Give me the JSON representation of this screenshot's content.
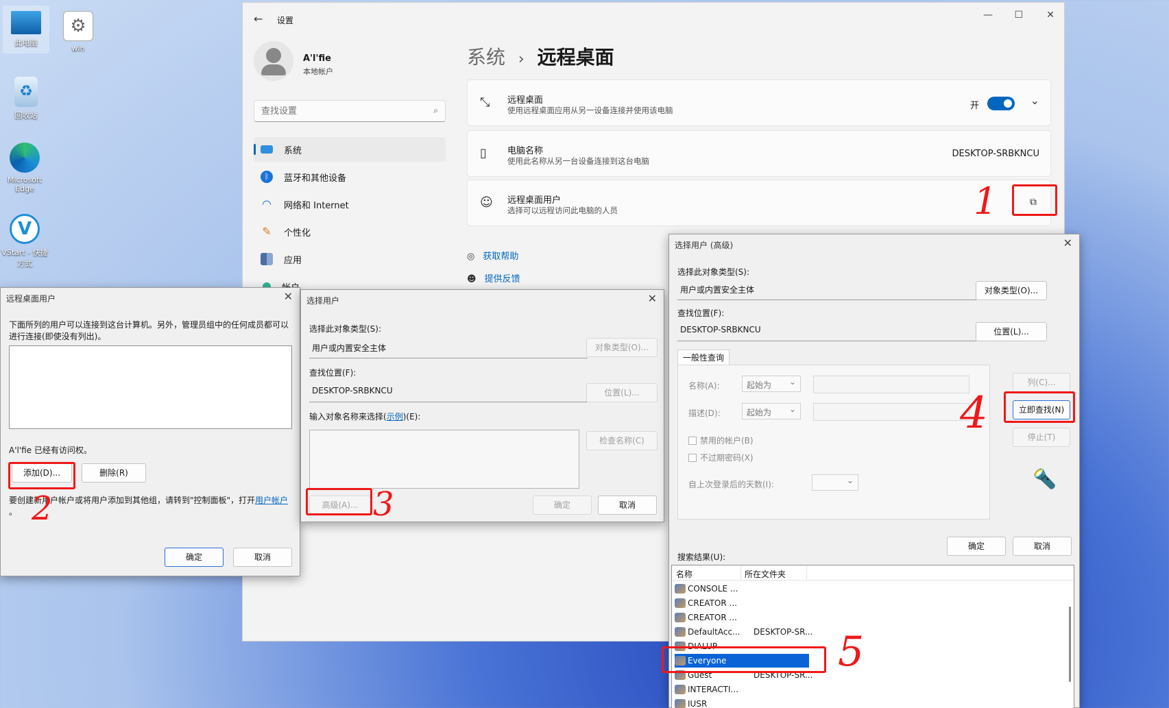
{
  "desktop": {
    "icons": [
      {
        "label": "此电脑"
      },
      {
        "label": "win"
      },
      {
        "label": "回收站"
      },
      {
        "label": "Microsoft Edge"
      },
      {
        "label": "VStart - 快捷方式"
      }
    ]
  },
  "settings": {
    "caption": "设置",
    "user_name": "A'l'fie",
    "user_type": "本地帐户",
    "search_placeholder": "查找设置",
    "nav": [
      {
        "label": "系统"
      },
      {
        "label": "蓝牙和其他设备"
      },
      {
        "label": "网络和 Internet"
      },
      {
        "label": "个性化"
      },
      {
        "label": "应用"
      },
      {
        "label": "帐户"
      }
    ],
    "breadcrumb_parent": "系统",
    "breadcrumb_sep": "›",
    "page_title": "远程桌面",
    "cards": {
      "remote_desktop": {
        "title": "远程桌面",
        "sub": "使用远程桌面应用从另一设备连接并使用该电脑",
        "toggle_label": "开"
      },
      "pc_name": {
        "title": "电脑名称",
        "sub": "使用此名称从另一台设备连接到这台电脑",
        "value": "DESKTOP-SRBKNCU"
      },
      "rd_users": {
        "title": "远程桌面用户",
        "sub": "选择可以远程访问此电脑的人员"
      }
    },
    "help": "获取帮助",
    "feedback": "提供反馈"
  },
  "rdu_dialog": {
    "title": "远程桌面用户",
    "desc": "下面所列的用户可以连接到这台计算机。另外，管理员组中的任何成员都可以进行连接(即使没有列出)。",
    "access_text": "A'l'fie 已经有访问权。",
    "add": "添加(D)...",
    "remove": "删除(R)",
    "info_pre": "要创建新用户帐户或将用户添加到其他组，请转到\"控制面板\"，打开",
    "info_link": "用户帐户",
    "info_post": "。",
    "ok": "确定",
    "cancel": "取消"
  },
  "su_dialog": {
    "title": "选择用户",
    "obj_type_label": "选择此对象类型(S):",
    "obj_type_value": "用户或内置安全主体",
    "obj_type_btn": "对象类型(O)...",
    "location_label": "查找位置(F):",
    "location_value": "DESKTOP-SRBKNCU",
    "location_btn": "位置(L)...",
    "enter_label_pre": "输入对象名称来选择(",
    "enter_label_link": "示例",
    "enter_label_post": ")(E):",
    "check_btn": "检查名称(C)",
    "advanced_btn": "高级(A)...",
    "ok": "确定",
    "cancel": "取消"
  },
  "adv_dialog": {
    "title": "选择用户 (高级)",
    "obj_type_label": "选择此对象类型(S):",
    "obj_type_value": "用户或内置安全主体",
    "obj_type_btn": "对象类型(O)...",
    "location_label": "查找位置(F):",
    "location_value": "DESKTOP-SRBKNCU",
    "location_btn": "位置(L)...",
    "tab": "一般性查询",
    "name_label": "名称(A):",
    "name_mode": "起始为",
    "desc_label": "描述(D):",
    "desc_mode": "起始为",
    "disabled_accounts": "禁用的帐户(B)",
    "no_expire": "不过期密码(X)",
    "days_label": "自上次登录后的天数(I):",
    "columns_btn": "列(C)...",
    "find_now_btn": "立即查找(N)",
    "stop_btn": "停止(T)",
    "ok": "确定",
    "cancel": "取消",
    "results_label": "搜索结果(U):",
    "col_name": "名称",
    "col_folder": "所在文件夹",
    "results": [
      {
        "name": "CONSOLE ...",
        "folder": ""
      },
      {
        "name": "CREATOR ...",
        "folder": ""
      },
      {
        "name": "CREATOR ...",
        "folder": ""
      },
      {
        "name": "DefaultAcc...",
        "folder": "DESKTOP-SR..."
      },
      {
        "name": "DIALUP",
        "folder": ""
      },
      {
        "name": "Everyone",
        "folder": ""
      },
      {
        "name": "Guest",
        "folder": "DESKTOP-SR..."
      },
      {
        "name": "INTERACTI...",
        "folder": ""
      },
      {
        "name": "IUSR",
        "folder": ""
      }
    ]
  },
  "annotations": [
    "1",
    "2",
    "3",
    "4",
    "5"
  ],
  "colors": {
    "accent": "#0067c0",
    "annotation_red": "#f01818",
    "toggle_on": "#0067c0"
  }
}
